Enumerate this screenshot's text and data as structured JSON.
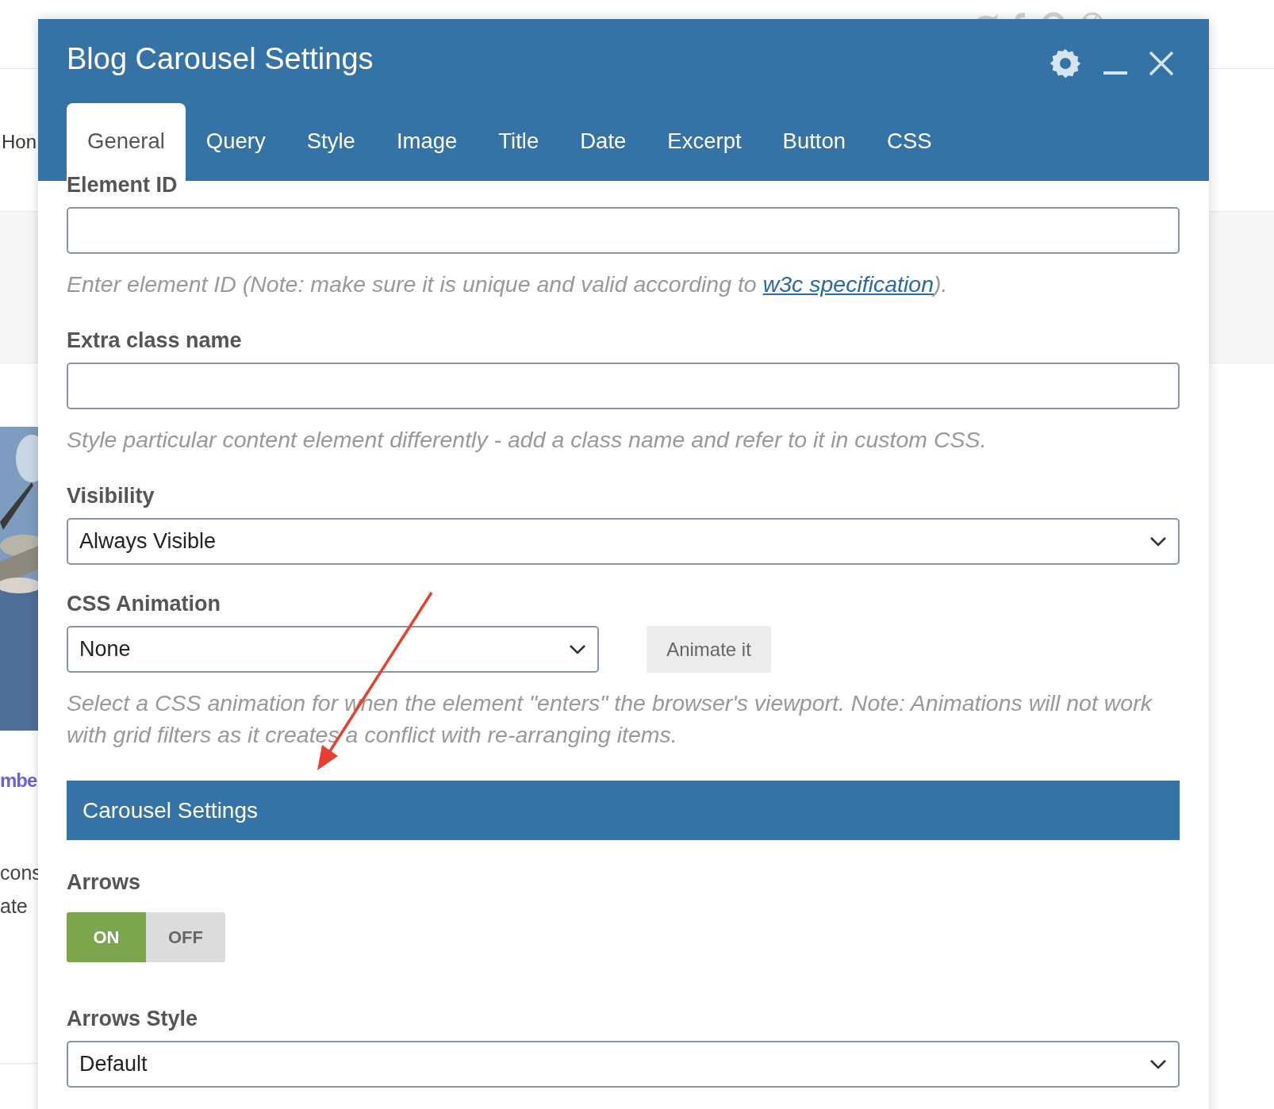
{
  "background_page": {
    "nav_text": "Hon",
    "link_text": "mbe",
    "text_lines": [
      "cons",
      "ate"
    ]
  },
  "modal": {
    "title": "Blog Carousel Settings",
    "tabs": [
      {
        "label": "General",
        "selected": true
      },
      {
        "label": "Query",
        "selected": false
      },
      {
        "label": "Style",
        "selected": false
      },
      {
        "label": "Image",
        "selected": false
      },
      {
        "label": "Title",
        "selected": false
      },
      {
        "label": "Date",
        "selected": false
      },
      {
        "label": "Excerpt",
        "selected": false
      },
      {
        "label": "Button",
        "selected": false
      },
      {
        "label": "CSS",
        "selected": false
      }
    ],
    "fields": [
      {
        "kind": "text",
        "label": "Element ID",
        "help_before": "Enter element ID (Note: make sure it is unique and valid according to ",
        "help_link": "w3c specification",
        "help_after": ")."
      },
      {
        "kind": "text",
        "label": "Extra class name",
        "help_before": "Style particular content element differently - add a class name and refer to it in custom CSS."
      },
      {
        "kind": "select",
        "label": "Visibility",
        "value": "Always Visible"
      },
      {
        "kind": "select_button",
        "label": "CSS Animation",
        "value": "None",
        "button": "Animate it",
        "help_before": "Select a CSS animation for when the element \"enters\" the browser's viewport. Note: Animations will not work with grid filters as it creates a conflict with re-arranging items."
      },
      {
        "kind": "section",
        "label": "Carousel Settings"
      },
      {
        "kind": "toggle",
        "label": "Arrows",
        "options": [
          {
            "label": "ON",
            "selected": true
          },
          {
            "label": "OFF",
            "selected": false
          }
        ]
      },
      {
        "kind": "select",
        "label": "Arrows Style",
        "value": "Default"
      }
    ]
  }
}
